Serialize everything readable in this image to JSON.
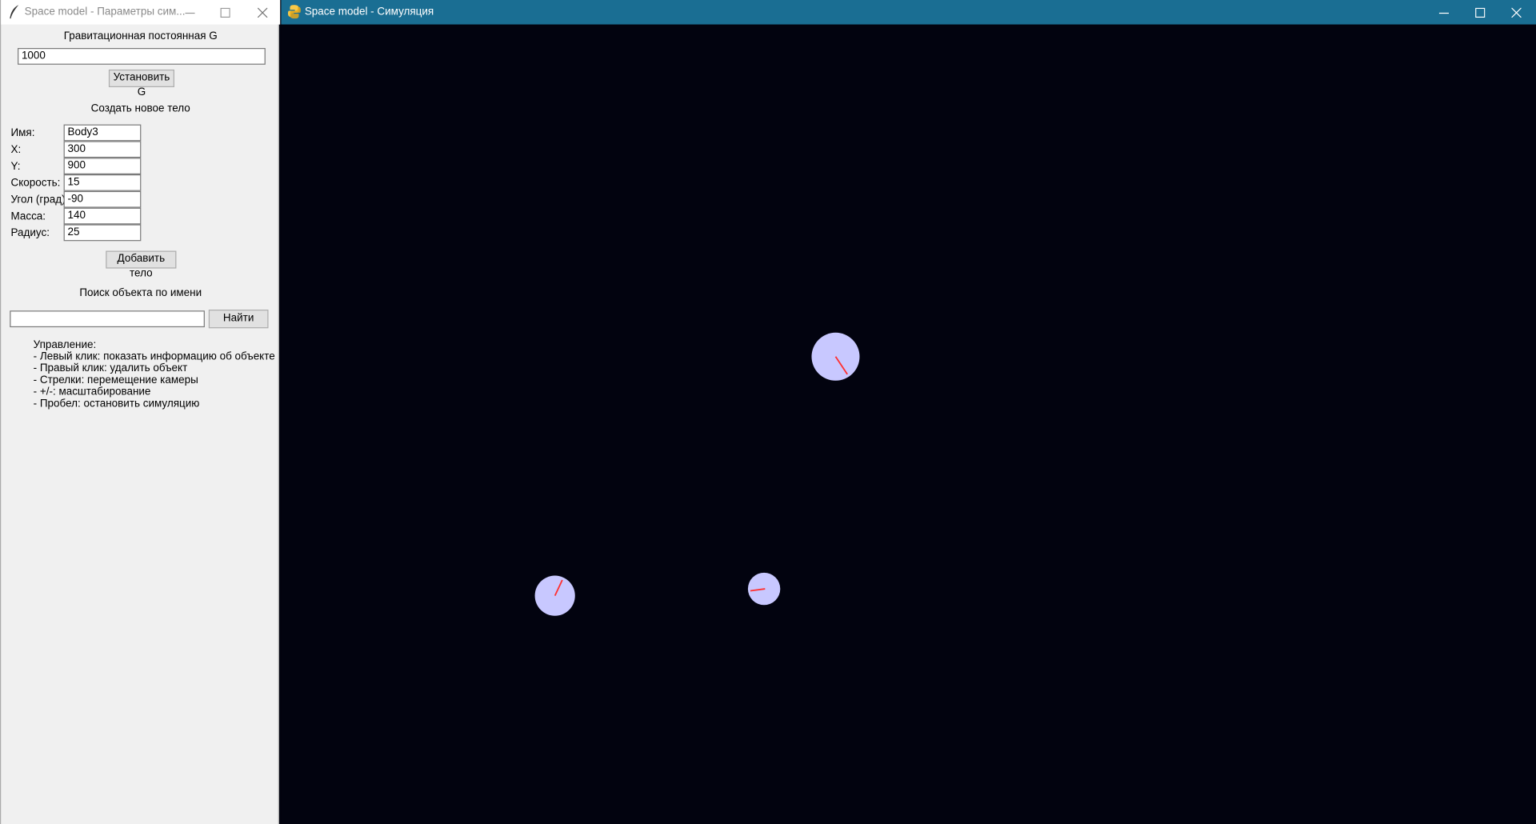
{
  "params_window": {
    "title": "Space model - Параметры сим...",
    "gravity": {
      "heading": "Гравитационная постоянная G",
      "value": "1000",
      "set_button": "Установить G"
    },
    "new_body": {
      "heading": "Создать новое тело",
      "fields": {
        "name": {
          "label": "Имя:",
          "value": "Body3"
        },
        "x": {
          "label": "X:",
          "value": "300"
        },
        "y": {
          "label": "Y:",
          "value": "900"
        },
        "speed": {
          "label": "Скорость:",
          "value": "15"
        },
        "angle": {
          "label": "Угол (град):",
          "value": "-90"
        },
        "mass": {
          "label": "Масса:",
          "value": "140"
        },
        "radius": {
          "label": "Радиус:",
          "value": "25"
        }
      },
      "add_button": "Добавить тело"
    },
    "search": {
      "heading": "Поиск объекта по имени",
      "value": "",
      "find_button": "Найти"
    },
    "help": {
      "title": "Управление:",
      "lines": [
        "- Левый клик: показать информацию об объекте",
        "- Правый клик: удалить объект",
        "- Стрелки: перемещение камеры",
        "- +/-: масштабирование",
        "- Пробел: остановить симуляцию"
      ]
    }
  },
  "sim_window": {
    "title": "Space model - Симуляция"
  },
  "colors": {
    "space_background": "#02030f",
    "body_fill": "#c8c8ff",
    "velocity_vector": "#ff3030",
    "sim_titlebar": "#1a6e93"
  }
}
